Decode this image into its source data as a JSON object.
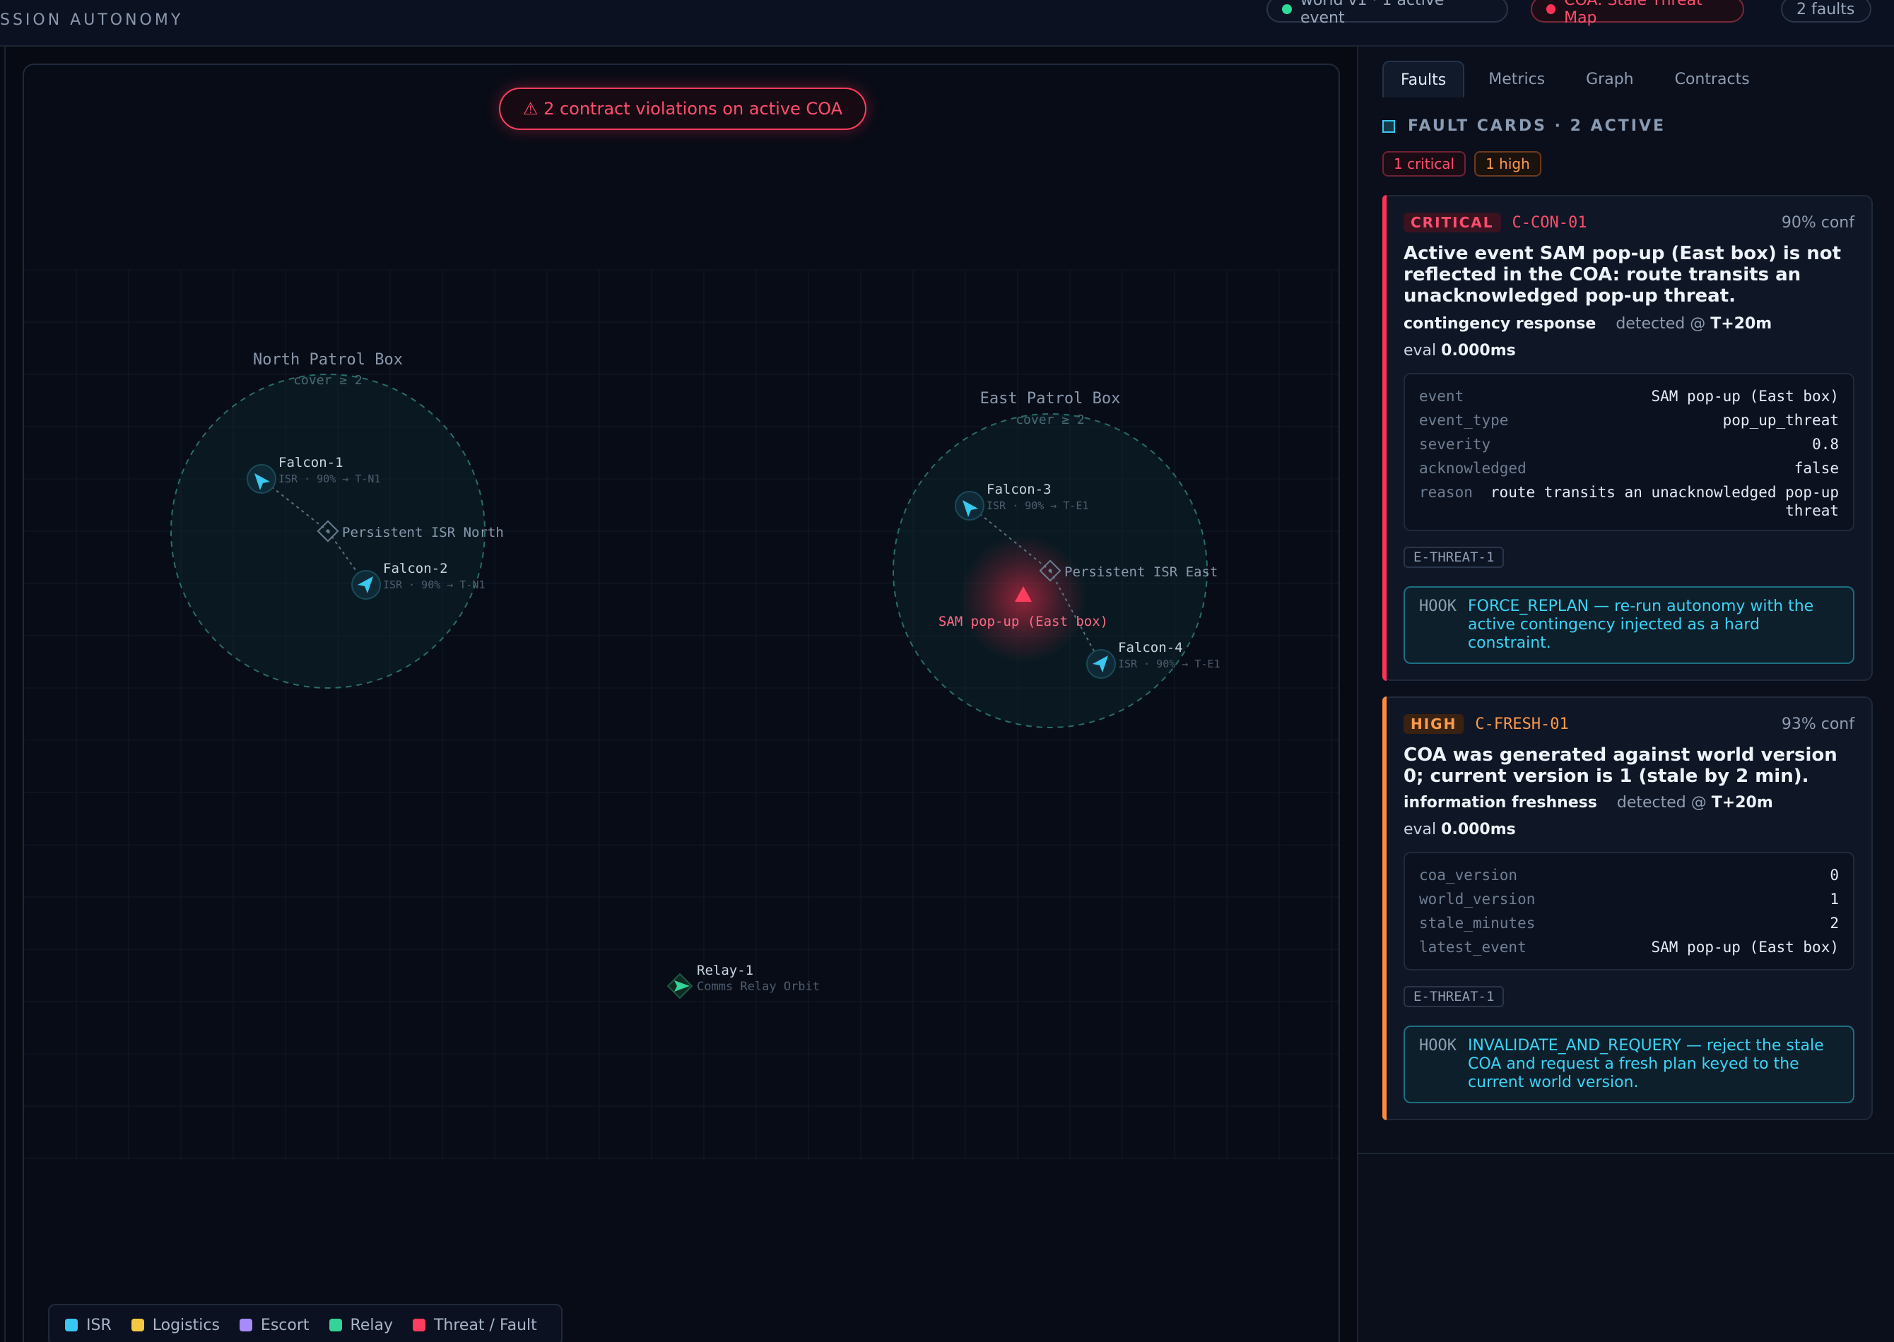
{
  "header": {
    "app_title": "SSION AUTONOMY",
    "world_pill": "world v1 · 1 active event",
    "coa_pill": "COA: Stale Threat Map",
    "faults_pill": "2 faults"
  },
  "map": {
    "violation_banner": "⚠ 2 contract violations on active COA",
    "zones": {
      "north": {
        "name": "North Patrol Box",
        "cover": "cover ≥ 2",
        "objective": "Persistent ISR North"
      },
      "east": {
        "name": "East Patrol Box",
        "cover": "cover ≥ 2",
        "objective": "Persistent ISR East"
      }
    },
    "assets": {
      "falcon1": {
        "name": "Falcon-1",
        "sub": "ISR · 90% → T-N1"
      },
      "falcon2": {
        "name": "Falcon-2",
        "sub": "ISR · 90% → T-N1"
      },
      "falcon3": {
        "name": "Falcon-3",
        "sub": "ISR · 90% → T-E1"
      },
      "falcon4": {
        "name": "Falcon-4",
        "sub": "ISR · 90% → T-E1"
      },
      "relay1": {
        "name": "Relay-1",
        "sub": "Comms Relay Orbit"
      }
    },
    "threat": {
      "name": "SAM pop-up (East box)"
    },
    "legend": [
      {
        "label": "ISR",
        "color": "#38c8f0"
      },
      {
        "label": "Logistics",
        "color": "#f5c842"
      },
      {
        "label": "Escort",
        "color": "#a78bfa"
      },
      {
        "label": "Relay",
        "color": "#34d399"
      },
      {
        "label": "Threat / Fault",
        "color": "#ff3d5e"
      }
    ]
  },
  "panel": {
    "tabs": [
      "Faults",
      "Metrics",
      "Graph",
      "Contracts"
    ],
    "section_title": "FAULT CARDS · 2 ACTIVE",
    "badge_critical": "1 critical",
    "badge_high": "1 high",
    "cards": [
      {
        "severity": "CRITICAL",
        "code": "C-CON-01",
        "confidence": "90% conf",
        "title": "Active event SAM pop-up (East box) is not reflected in the COA: route transits an unacknowledged pop-up threat.",
        "category": "contingency response",
        "detected_label": "detected @",
        "detected_time": "T+20m",
        "eval_label": "eval",
        "eval_value": "0.000ms",
        "kv": [
          {
            "k": "event",
            "v": "SAM pop-up (East box)"
          },
          {
            "k": "event_type",
            "v": "pop_up_threat"
          },
          {
            "k": "severity",
            "v": "0.8"
          },
          {
            "k": "acknowledged",
            "v": "false"
          },
          {
            "k": "reason",
            "v": "route transits an unacknowledged pop-up threat"
          }
        ],
        "tag": "E-THREAT-1",
        "hook_label": "HOOK",
        "hook_text": "FORCE_REPLAN — re-run autonomy with the active contingency injected as a hard constraint."
      },
      {
        "severity": "HIGH",
        "code": "C-FRESH-01",
        "confidence": "93% conf",
        "title": "COA was generated against world version 0; current version is 1 (stale by 2 min).",
        "category": "information freshness",
        "detected_label": "detected @",
        "detected_time": "T+20m",
        "eval_label": "eval",
        "eval_value": "0.000ms",
        "kv": [
          {
            "k": "coa_version",
            "v": "0"
          },
          {
            "k": "world_version",
            "v": "1"
          },
          {
            "k": "stale_minutes",
            "v": "2"
          },
          {
            "k": "latest_event",
            "v": "SAM pop-up (East box)"
          }
        ],
        "tag": "E-THREAT-1",
        "hook_label": "HOOK",
        "hook_text": "INVALIDATE_AND_REQUERY — reject the stale COA and request a fresh plan keyed to the current world version."
      }
    ]
  }
}
